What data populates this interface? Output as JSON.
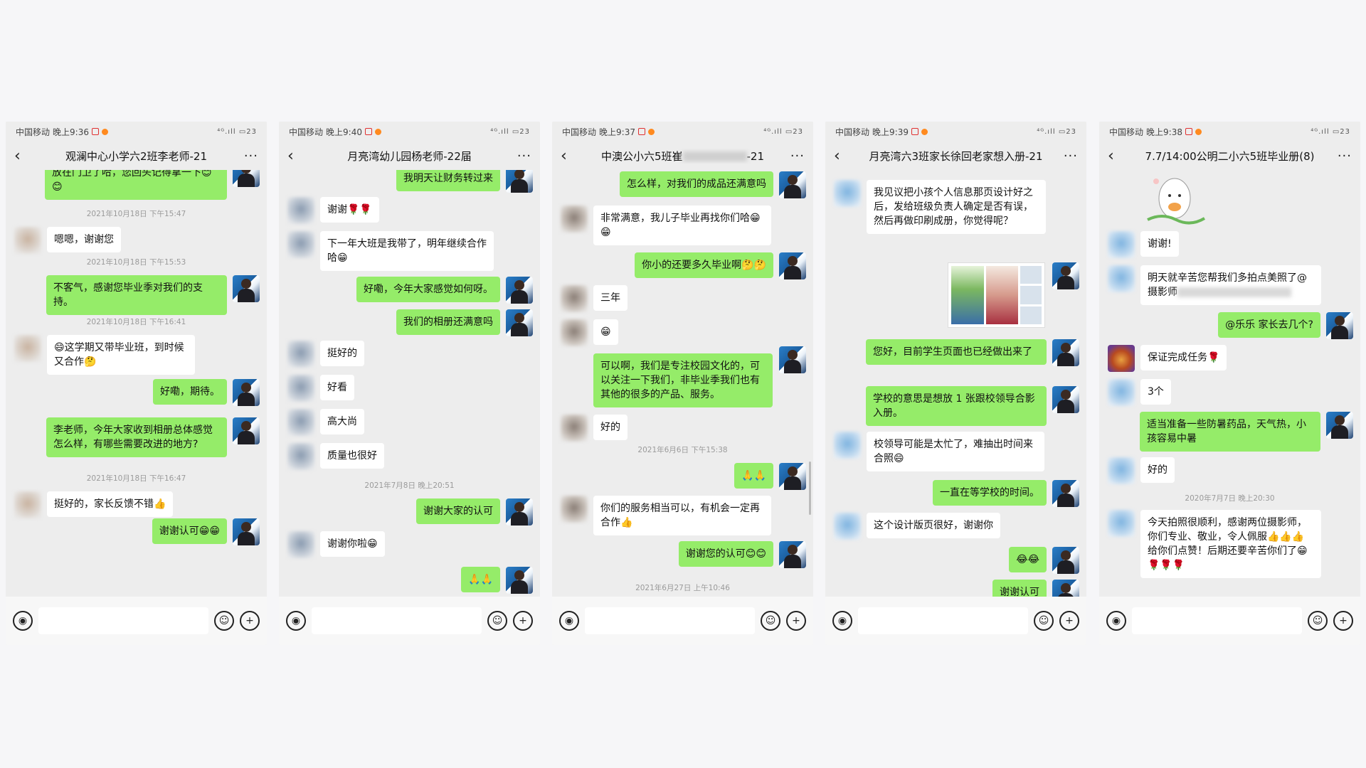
{
  "status": {
    "carrier": "中国移动",
    "battery": "23"
  },
  "phones": [
    {
      "time": "晚上9:36",
      "title": "观澜中心小学六2班李老师-21",
      "messages": [
        "放在门卫了哈，您回头记得拿一下😊😊",
        "2021年10月18日 下午15:47",
        "嗯嗯，谢谢您",
        "2021年10月18日 下午15:53",
        "不客气，感谢您毕业季对我们的支持。",
        "2021年10月18日 下午16:41",
        "😄这学期又带毕业班，到时候又合作🤔",
        "好嘞，期待。",
        "李老师，今年大家收到相册总体感觉怎么样，有哪些需要改进的地方?",
        "2021年10月18日 下午16:47",
        "挺好的，家长反馈不错👍",
        "谢谢认可😁😁"
      ]
    },
    {
      "time": "晚上9:40",
      "title": "月亮湾幼儿园杨老师-22届",
      "messages": [
        "我明天让财务转过来",
        "谢谢🌹🌹",
        "下一年大班是我带了，明年继续合作哈😁",
        "好嘞，今年大家感觉如何呀。",
        "我们的相册还满意吗",
        "挺好的",
        "好看",
        "高大尚",
        "质量也很好",
        "2021年7月8日 晚上20:51",
        "谢谢大家的认可",
        "谢谢你啦😁",
        "🙏🙏"
      ]
    },
    {
      "time": "晚上9:37",
      "title_a": "中澳公小六5班崔",
      "title_b": "-21",
      "messages": [
        "怎么样，对我们的成品还满意吗",
        "非常满意，我儿子毕业再找你们哈😁😁",
        "你小的还要多久毕业啊🤔🤔",
        "三年",
        "😁",
        "可以啊，我们是专注校园文化的，可以关注一下我们，非毕业季我们也有其他的很多的产品、服务。",
        "好的",
        "2021年6月6日 下午15:38",
        "🙏🙏",
        "你们的服务相当可以，有机会一定再合作👍",
        "谢谢您的认可😊😊",
        "2021年6月27日 上午10:46"
      ]
    },
    {
      "time": "晚上9:39",
      "title": "月亮湾六3班家长徐回老家想入册-21",
      "messages": [
        "我见议把小孩个人信息那页设计好之后，发给班级负责人确定是否有误，然后再做印刷成册，你觉得呢？",
        "您好，目前学生页面也已经做出来了",
        "学校的意思是想放 1 张跟校领导合影入册。",
        "校领导可能是太忙了，难抽出时间来合照😄",
        "一直在等学校的时间。",
        "这个设计版页很好，谢谢你",
        "😂😂",
        "谢谢认可"
      ]
    },
    {
      "time": "晚上9:38",
      "title": "7.7/14:00公明二小六5班毕业册(8)",
      "messages": [
        "谢谢!",
        "明天就辛苦您帮我们多拍点美照了@摄影师",
        "@乐乐  家长去几个?",
        "保证完成任务🌹",
        "3个",
        "适当准备一些防暑药品，天气热，小孩容易中暑",
        "好的",
        "2020年7月7日 晚上20:30",
        "今天拍照很顺利，感谢两位摄影师，你们专业、敬业，令人佩服👍👍👍给你们点赞！后期还要辛苦你们了😁🌹🌹🌹"
      ]
    }
  ]
}
